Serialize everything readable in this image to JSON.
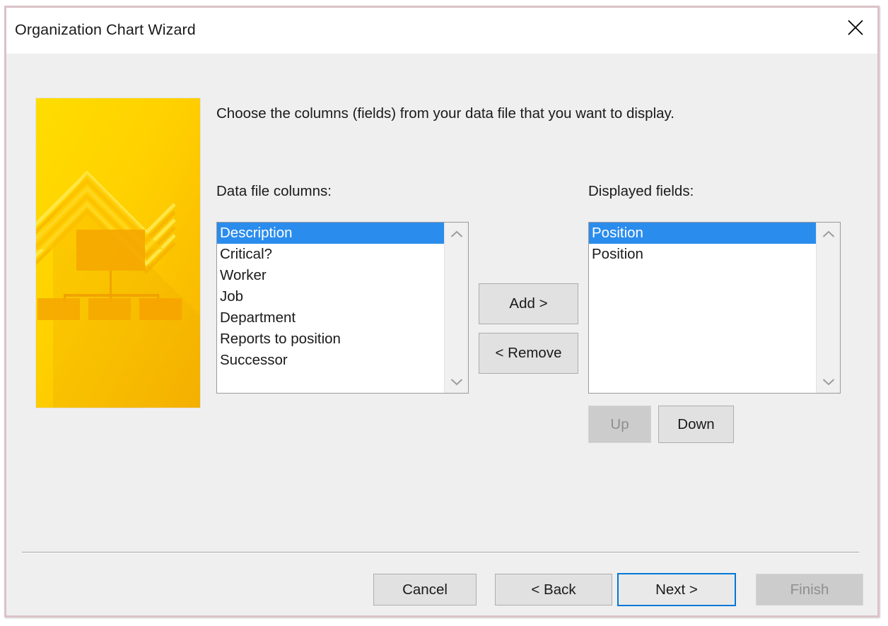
{
  "window": {
    "title": "Organization Chart Wizard",
    "close_icon": "close-icon"
  },
  "content": {
    "instruction": "Choose the columns (fields) from your data file that you want to display.",
    "illustration": {
      "name": "org-chart-illustration",
      "colors": {
        "yellow_light": "#ffd800",
        "yellow_mid": "#ffc800",
        "yellow_deep": "#f7b500",
        "accent_orange": "#f5a700"
      }
    }
  },
  "data_columns": {
    "label": "Data file columns:",
    "items": [
      {
        "text": "Description",
        "selected": true
      },
      {
        "text": "Critical?",
        "selected": false
      },
      {
        "text": "Worker",
        "selected": false
      },
      {
        "text": "Job",
        "selected": false
      },
      {
        "text": "Department",
        "selected": false
      },
      {
        "text": "Reports to position",
        "selected": false
      },
      {
        "text": "Successor",
        "selected": false
      }
    ],
    "scrollbar": {
      "up_icon": "chevron-up-icon",
      "down_icon": "chevron-down-icon"
    }
  },
  "displayed_fields": {
    "label": "Displayed fields:",
    "items": [
      {
        "text": "Position",
        "selected": true
      },
      {
        "text": "Position",
        "selected": false
      }
    ],
    "scrollbar": {
      "up_icon": "chevron-up-icon",
      "down_icon": "chevron-down-icon"
    }
  },
  "transfer_buttons": {
    "add_label": "Add >",
    "remove_label": "< Remove"
  },
  "order_buttons": {
    "up_label": "Up",
    "up_disabled": true,
    "down_label": "Down",
    "down_disabled": false
  },
  "footer": {
    "cancel_label": "Cancel",
    "back_label": "< Back",
    "next_label": "Next >",
    "next_focused": true,
    "finish_label": "Finish",
    "finish_disabled": true
  },
  "colors": {
    "selection_blue": "#2a8ced",
    "focus_blue": "#0078d7",
    "window_border": "#dbc3c8",
    "dialog_background": "#efefef",
    "titlebar_background": "#ffffff",
    "button_face": "#e1e1e1",
    "button_disabled": "#cccccc"
  }
}
